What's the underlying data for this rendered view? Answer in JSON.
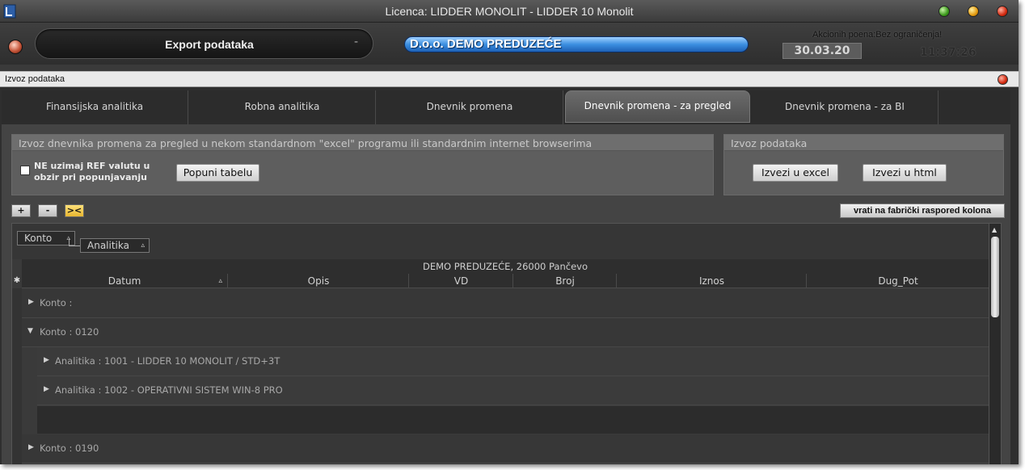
{
  "window": {
    "title": "Licenca: LIDDER MONOLIT - LIDDER 10 Monolit",
    "app_icon": "lidder-app-icon",
    "controls": [
      "minimize-green",
      "maximize-yellow",
      "close-red"
    ]
  },
  "header": {
    "module_label": "Export podataka",
    "module_dash": "-",
    "company": "D.o.o. DEMO PREDUZEĆE",
    "promo": "Akcionih poena:Bez ograničenja!",
    "date": "30.03.20",
    "time": "11:37:26"
  },
  "inner_window": {
    "title": "Izvoz podataka"
  },
  "tabs": [
    {
      "label": "Finansijska analitika",
      "active": false
    },
    {
      "label": "Robna analitika",
      "active": false
    },
    {
      "label": "Dnevnik promena",
      "active": false
    },
    {
      "label": "Dnevnik promena - za pregled",
      "active": true
    },
    {
      "label": "Dnevnik promena - za BI",
      "active": false
    }
  ],
  "left_panel": {
    "title": "Izvoz dnevnika promena za pregled u nekom standardnom \"excel\" programu ili standardnim internet browserima",
    "checkbox_label_line1": "NE uzimaj REF valutu u",
    "checkbox_label_line2": "obzir pri popunjavanju",
    "checkbox_checked": false,
    "fill_button": "Popuni tabelu"
  },
  "right_panel": {
    "title": "Izvoz podataka",
    "excel_button": "Izvezi u excel",
    "html_button": "Izvezi u html"
  },
  "toolbar": {
    "expand": "+",
    "collapse": "-",
    "fit": "><",
    "factory_layout": "vrati na fabrički raspored kolona"
  },
  "grid": {
    "group_by": [
      {
        "label": "Konto",
        "sort": "▵"
      },
      {
        "label": "Analitika",
        "sort": "▵"
      }
    ],
    "banner": "DEMO PREDUZEĆE, 26000 Pančevo",
    "star": "✱",
    "columns": [
      {
        "label": "Datum",
        "sort": "▵"
      },
      {
        "label": "Opis"
      },
      {
        "label": "VD"
      },
      {
        "label": "Broj"
      },
      {
        "label": "Iznos"
      },
      {
        "label": "Dug_Pot"
      }
    ],
    "rows": [
      {
        "level": 0,
        "expanded": false,
        "label": "Konto :"
      },
      {
        "level": 0,
        "expanded": true,
        "label": "Konto : 0120"
      },
      {
        "level": 1,
        "expanded": false,
        "label": "Analitika : 1001 - LIDDER 10 MONOLIT / STD+3T"
      },
      {
        "level": 1,
        "expanded": false,
        "label": "Analitika : 1002 - OPERATIVNI SISTEM WIN-8 PRO"
      },
      {
        "level": 0,
        "expanded": false,
        "label": "Konto : 0190"
      }
    ]
  }
}
